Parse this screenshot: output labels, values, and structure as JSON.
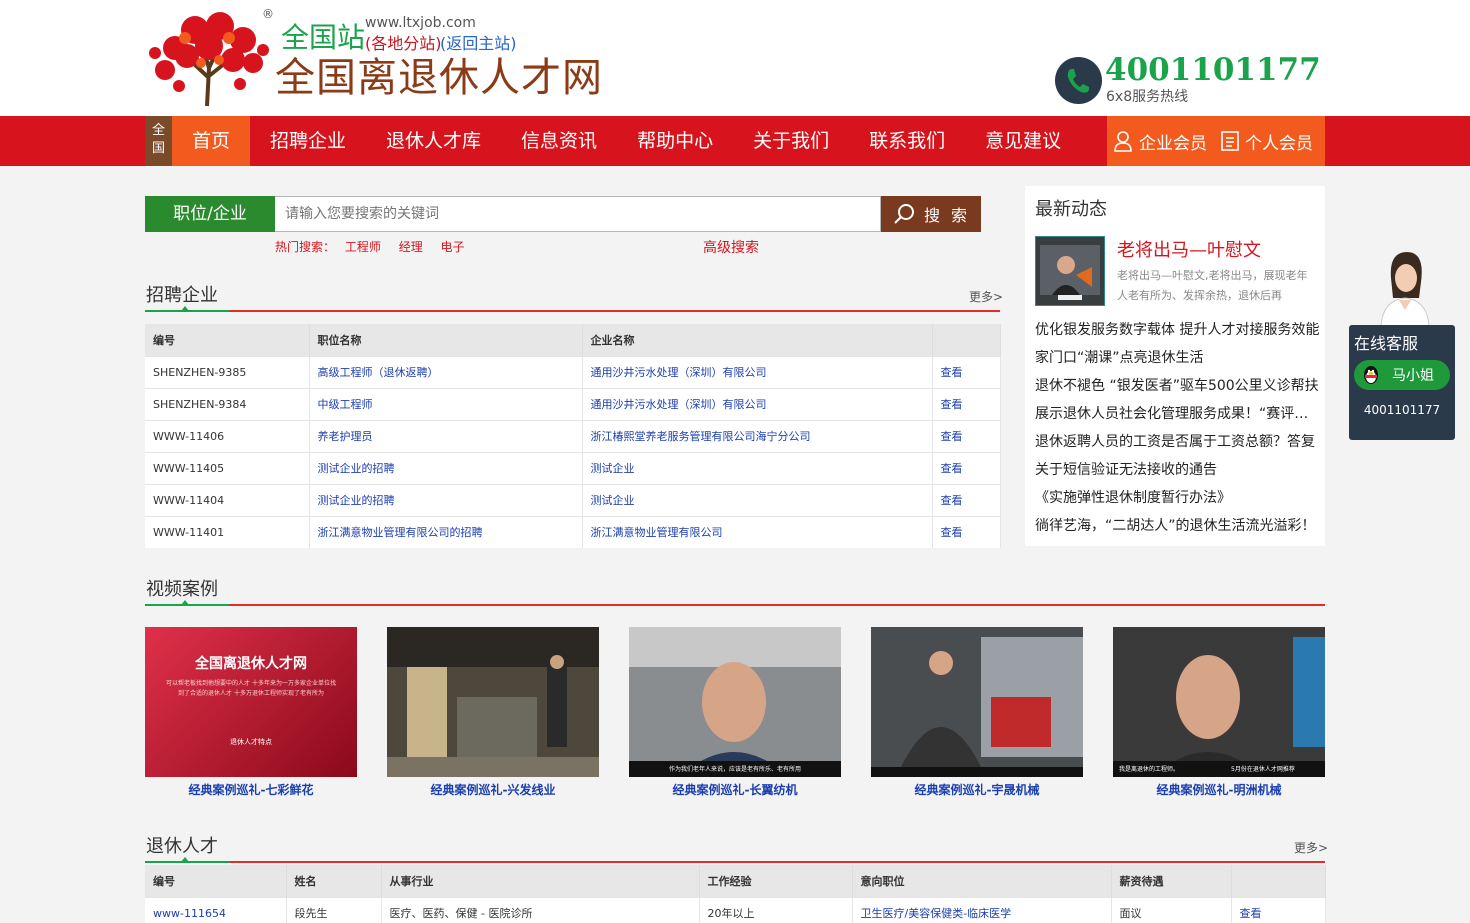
{
  "header": {
    "registered": "®",
    "station": "全国站",
    "url": "www.ltxjob.com",
    "branch": "(各地分站)",
    "return_main": "(返回主站)",
    "site_name": "全国离退休人才网",
    "phone": "4001101177",
    "phone_label": "6x8服务热线"
  },
  "nav": {
    "region": "全国",
    "items": [
      "首页",
      "招聘企业",
      "退休人才库",
      "信息资讯",
      "帮助中心",
      "关于我们",
      "联系我们",
      "意见建议"
    ],
    "enterprise_member": "企业会员",
    "personal_member": "个人会员"
  },
  "search": {
    "tab": "职位/企业",
    "placeholder": "请输入您要搜索的关键词",
    "button": "搜 索",
    "hot_label": "热门搜索：",
    "hot_keywords": [
      "工程师",
      "经理",
      "电子"
    ],
    "advanced": "高级搜索"
  },
  "jobs": {
    "title": "招聘企业",
    "more": "更多>",
    "columns": [
      "编号",
      "职位名称",
      "企业名称",
      ""
    ],
    "rows": [
      [
        "SHENZHEN-9385",
        "高级工程师（退休返聘）",
        "通用沙井污水处理（深圳）有限公司",
        "查看"
      ],
      [
        "SHENZHEN-9384",
        "中级工程师",
        "通用沙井污水处理（深圳）有限公司",
        "查看"
      ],
      [
        "WWW-11406",
        "养老护理员",
        "浙江椿熙堂养老服务管理有限公司海宁分公司",
        "查看"
      ],
      [
        "WWW-11405",
        "测试企业的招聘",
        "测试企业",
        "查看"
      ],
      [
        "WWW-11404",
        "测试企业的招聘",
        "测试企业",
        "查看"
      ],
      [
        "WWW-11401",
        "浙江满意物业管理有限公司的招聘",
        "浙江满意物业管理有限公司",
        "查看"
      ]
    ]
  },
  "news": {
    "title": "最新动态",
    "featured_title": "老将出马—叶慰文",
    "featured_summary": "老将出马—叶慰文,老将出马，展现老年人老有所为、发挥余热，退休后再",
    "items": [
      "优化银发服务数字载体 提升人才对接服务效能",
      "家门口“潮课”点亮退休生活",
      "退休不褪色 “银发医者”驱车500公里义诊帮扶",
      "展示退休人员社会化管理服务成果！“赛评晒”活动",
      "退休返聘人员的工资是否属于工资总额？答复",
      "关于短信验证无法接收的通告",
      "《实施弹性退休制度暂行办法》",
      "徜徉艺海，“二胡达人”的退休生活流光溢彩！"
    ]
  },
  "videos": {
    "title": "视频案例",
    "items": [
      {
        "caption": "经典案例巡礼-七彩鲜花",
        "thumb_title": "全国离退休人才网",
        "thumb_text": "可以帮老板找到他想要中的人才 十多年来为一万多家企业单位找到了合适的退休人才 十多万退休工程师实现了老有所为",
        "thumb_subtitle": "退休人才特点"
      },
      {
        "caption": "经典案例巡礼-兴发线业"
      },
      {
        "caption": "经典案例巡礼-长翼纺机",
        "thumb_subtitle": "作为我们老年人来说，应该是老有所乐、老有所用"
      },
      {
        "caption": "经典案例巡礼-宇晟机械"
      },
      {
        "caption": "经典案例巡礼-明洲机械",
        "thumb_subtitle": "我是离退休的工程师。",
        "thumb_subtitle2": "5月份在退休人才网推荐"
      }
    ]
  },
  "talents": {
    "title": "退休人才",
    "more": "更多>",
    "columns": [
      "编号",
      "姓名",
      "从事行业",
      "工作经验",
      "意向职位",
      "薪资待遇",
      ""
    ],
    "rows": [
      [
        "www-111654",
        "段先生",
        "医疗、医药、保健 - 医院诊所",
        "20年以上",
        "卫生医疗/美容保健类-临床医学",
        "面议",
        "查看"
      ]
    ]
  },
  "service": {
    "title": "在线客服",
    "agent": "马小姐",
    "phone": "4001101177"
  },
  "colors": {
    "nav_red": "#d7141d",
    "nav_orange": "#f35a1d",
    "green": "#1aa34a",
    "link_blue": "#1b3fae"
  }
}
